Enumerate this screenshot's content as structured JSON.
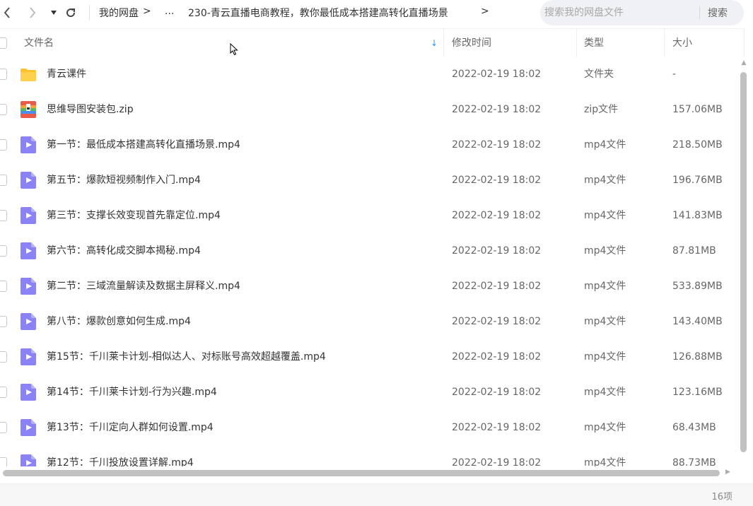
{
  "nav": {
    "back_icon": "chevron-left-icon",
    "forward_icon": "chevron-right-icon",
    "history_icon": "caret-down-icon",
    "refresh_icon": "refresh-icon"
  },
  "breadcrumb": {
    "root": "我的网盘",
    "arrow": ">",
    "ellipsis": "...",
    "current": "230-青云直播电商教程，教你最低成本搭建高转化直播场景"
  },
  "search": {
    "placeholder": "搜索我的网盘文件",
    "button_label": "搜索"
  },
  "columns": {
    "name": "文件名",
    "sort_indicator": "↓",
    "modified": "修改时间",
    "type": "类型",
    "size": "大小"
  },
  "files": [
    {
      "name": "青云课件",
      "modified": "2022-02-19 18:02",
      "type": "文件夹",
      "size": "-",
      "icon": "folder-icon"
    },
    {
      "name": "思维导图安装包.zip",
      "modified": "2022-02-19 18:02",
      "type": "zip文件",
      "size": "157.06MB",
      "icon": "zip-icon"
    },
    {
      "name": "第一节：最低成本搭建高转化直播场景.mp4",
      "modified": "2022-02-19 18:02",
      "type": "mp4文件",
      "size": "218.50MB",
      "icon": "video-icon"
    },
    {
      "name": "第五节：爆款短视频制作入门.mp4",
      "modified": "2022-02-19 18:02",
      "type": "mp4文件",
      "size": "196.76MB",
      "icon": "video-icon"
    },
    {
      "name": "第三节：支撑长效变现首先靠定位.mp4",
      "modified": "2022-02-19 18:02",
      "type": "mp4文件",
      "size": "141.83MB",
      "icon": "video-icon"
    },
    {
      "name": "第六节：高转化成交脚本揭秘.mp4",
      "modified": "2022-02-19 18:02",
      "type": "mp4文件",
      "size": "87.81MB",
      "icon": "video-icon"
    },
    {
      "name": "第二节：三域流量解读及数据主屏释义.mp4",
      "modified": "2022-02-19 18:02",
      "type": "mp4文件",
      "size": "533.89MB",
      "icon": "video-icon"
    },
    {
      "name": "第八节：爆款创意如何生成.mp4",
      "modified": "2022-02-19 18:02",
      "type": "mp4文件",
      "size": "143.40MB",
      "icon": "video-icon"
    },
    {
      "name": "第15节：千川莱卡计划-相似达人、对标账号高效超越覆盖.mp4",
      "modified": "2022-02-19 18:02",
      "type": "mp4文件",
      "size": "126.88MB",
      "icon": "video-icon"
    },
    {
      "name": "第14节：千川莱卡计划-行为兴趣.mp4",
      "modified": "2022-02-19 18:02",
      "type": "mp4文件",
      "size": "123.16MB",
      "icon": "video-icon"
    },
    {
      "name": "第13节：千川定向人群如何设置.mp4",
      "modified": "2022-02-19 18:02",
      "type": "mp4文件",
      "size": "68.43MB",
      "icon": "video-icon"
    },
    {
      "name": "第12节：千川投放设置详解.mp4",
      "modified": "2022-02-19 18:02",
      "type": "mp4文件",
      "size": "88.73MB",
      "icon": "video-icon"
    }
  ],
  "footer": {
    "item_count": "16项"
  },
  "colors": {
    "accent": "#2f8df7",
    "folder": "#ffc22e",
    "video": "#8b82f5",
    "zip": "#ea5a48"
  }
}
